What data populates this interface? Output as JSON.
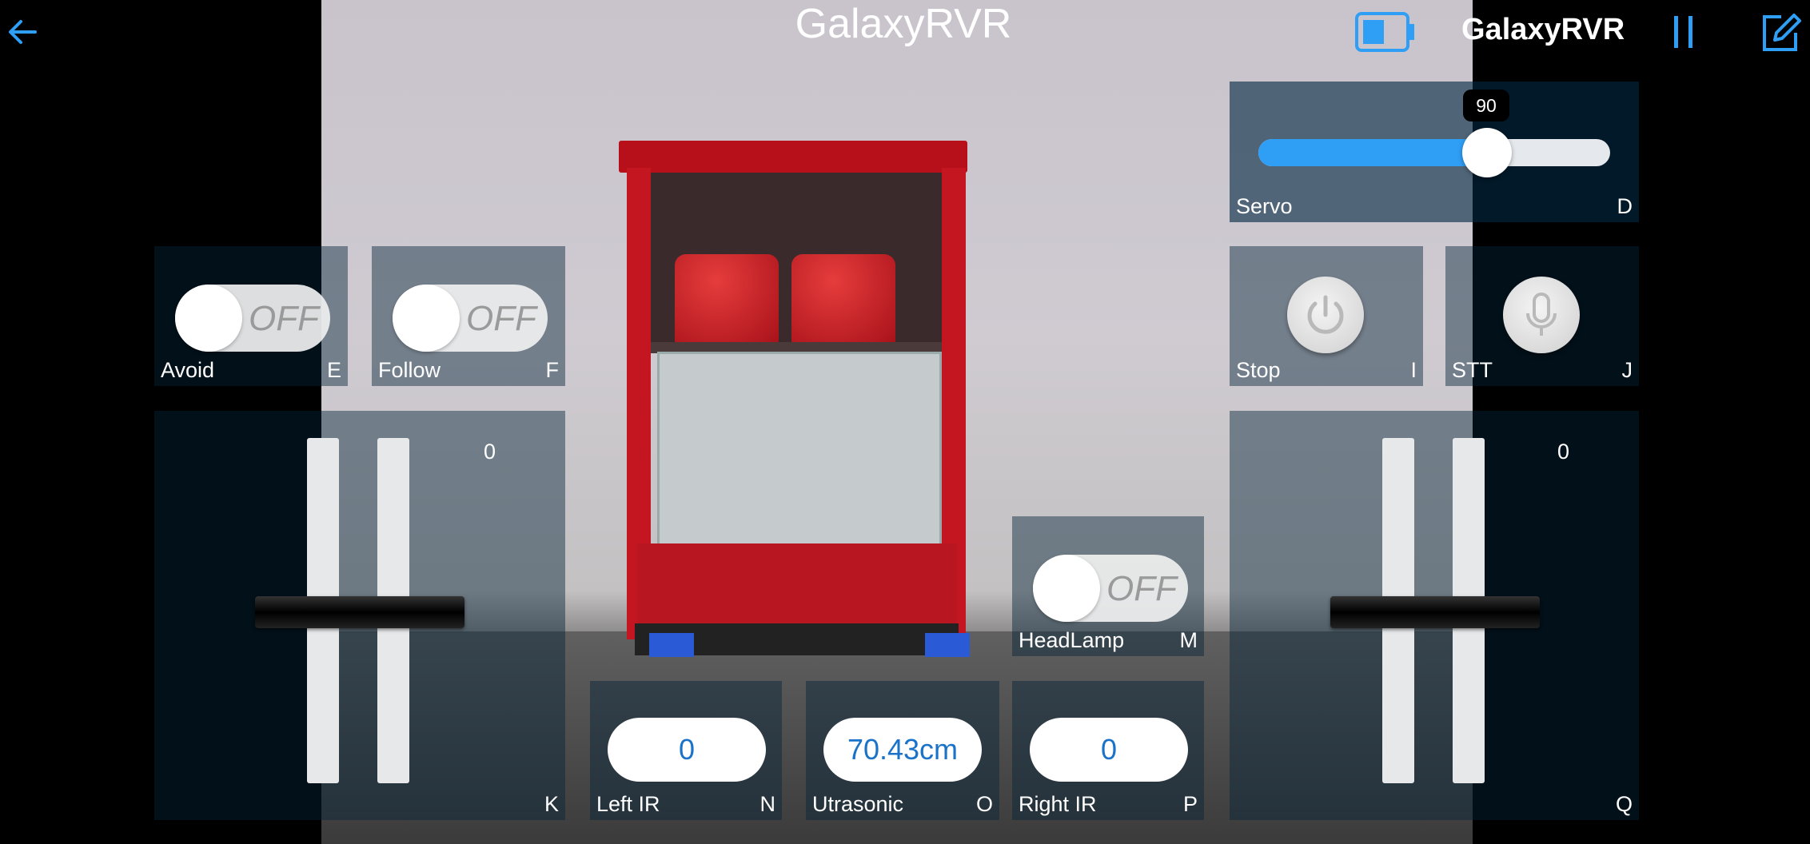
{
  "header": {
    "title": "GalaxyRVR",
    "device_name": "GalaxyRVR",
    "back_icon": "arrow-left-icon",
    "battery_icon": "battery-icon",
    "pause_icon": "pause-icon",
    "edit_icon": "edit-icon"
  },
  "servo": {
    "label": "Servo",
    "key": "D",
    "value": "90",
    "fraction": 0.66
  },
  "avoid": {
    "label": "Avoid",
    "key": "E",
    "state": "OFF"
  },
  "follow": {
    "label": "Follow",
    "key": "F",
    "state": "OFF"
  },
  "stop": {
    "label": "Stop",
    "key": "I",
    "icon": "power-icon"
  },
  "stt": {
    "label": "STT",
    "key": "J",
    "icon": "microphone-icon"
  },
  "left_throttle": {
    "key": "K",
    "value": "0"
  },
  "right_throttle": {
    "key": "Q",
    "value": "0"
  },
  "headlamp": {
    "label": "HeadLamp",
    "key": "M",
    "state": "OFF"
  },
  "left_ir": {
    "label": "Left IR",
    "key": "N",
    "value": "0"
  },
  "ultrasonic": {
    "label": "Utrasonic",
    "key": "O",
    "value": "70.43cm"
  },
  "right_ir": {
    "label": "Right IR",
    "key": "P",
    "value": "0"
  },
  "colors": {
    "accent": "#2f9ef5",
    "value_text": "#1a73c8"
  }
}
